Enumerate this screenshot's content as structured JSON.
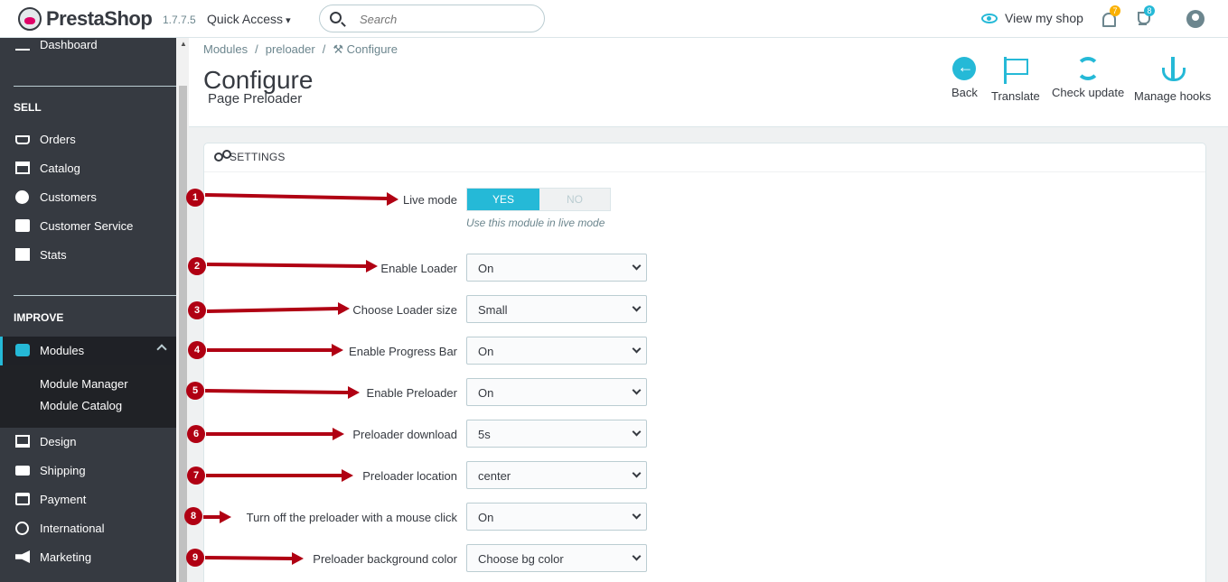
{
  "header": {
    "brand": "PrestaShop",
    "version": "1.7.7.5",
    "quick_access": "Quick Access",
    "search_placeholder": "Search",
    "view_shop": "View my shop",
    "notifications_count": "7",
    "trophy_count": "8"
  },
  "sidebar": {
    "dashboard": "Dashboard",
    "sell_title": "SELL",
    "sell_items": [
      "Orders",
      "Catalog",
      "Customers",
      "Customer Service",
      "Stats"
    ],
    "improve_title": "IMPROVE",
    "modules": "Modules",
    "modules_sub": [
      "Module Manager",
      "Module Catalog"
    ],
    "improve_items": [
      "Design",
      "Shipping",
      "Payment",
      "International",
      "Marketing"
    ]
  },
  "breadcrumb": [
    "Modules",
    "preloader",
    "Configure"
  ],
  "page": {
    "title": "Configure",
    "subtitle": "Page Preloader"
  },
  "toolbar": {
    "back": "Back",
    "translate": "Translate",
    "check_update": "Check update",
    "manage_hooks": "Manage hooks"
  },
  "panel": {
    "title": "SETTINGS",
    "live_mode": {
      "label": "Live mode",
      "yes": "YES",
      "no": "NO",
      "help": "Use this module in live mode"
    },
    "fields": [
      {
        "number": "2",
        "label": "Enable Loader",
        "value": "On"
      },
      {
        "number": "3",
        "label": "Choose Loader size",
        "value": "Small"
      },
      {
        "number": "4",
        "label": "Enable Progress Bar",
        "value": "On"
      },
      {
        "number": "5",
        "label": "Enable Preloader",
        "value": "On"
      },
      {
        "number": "6",
        "label": "Preloader download",
        "value": "5s"
      },
      {
        "number": "7",
        "label": "Preloader location",
        "value": "center"
      },
      {
        "number": "8",
        "label": "Turn off the preloader with a mouse click",
        "value": "On"
      },
      {
        "number": "9",
        "label": "Preloader background color",
        "value": "Choose bg color"
      }
    ],
    "live_mode_number": "1"
  },
  "colors": {
    "accent": "#25b9d7",
    "sidebar": "#363a41",
    "annotation": "#b00013"
  }
}
